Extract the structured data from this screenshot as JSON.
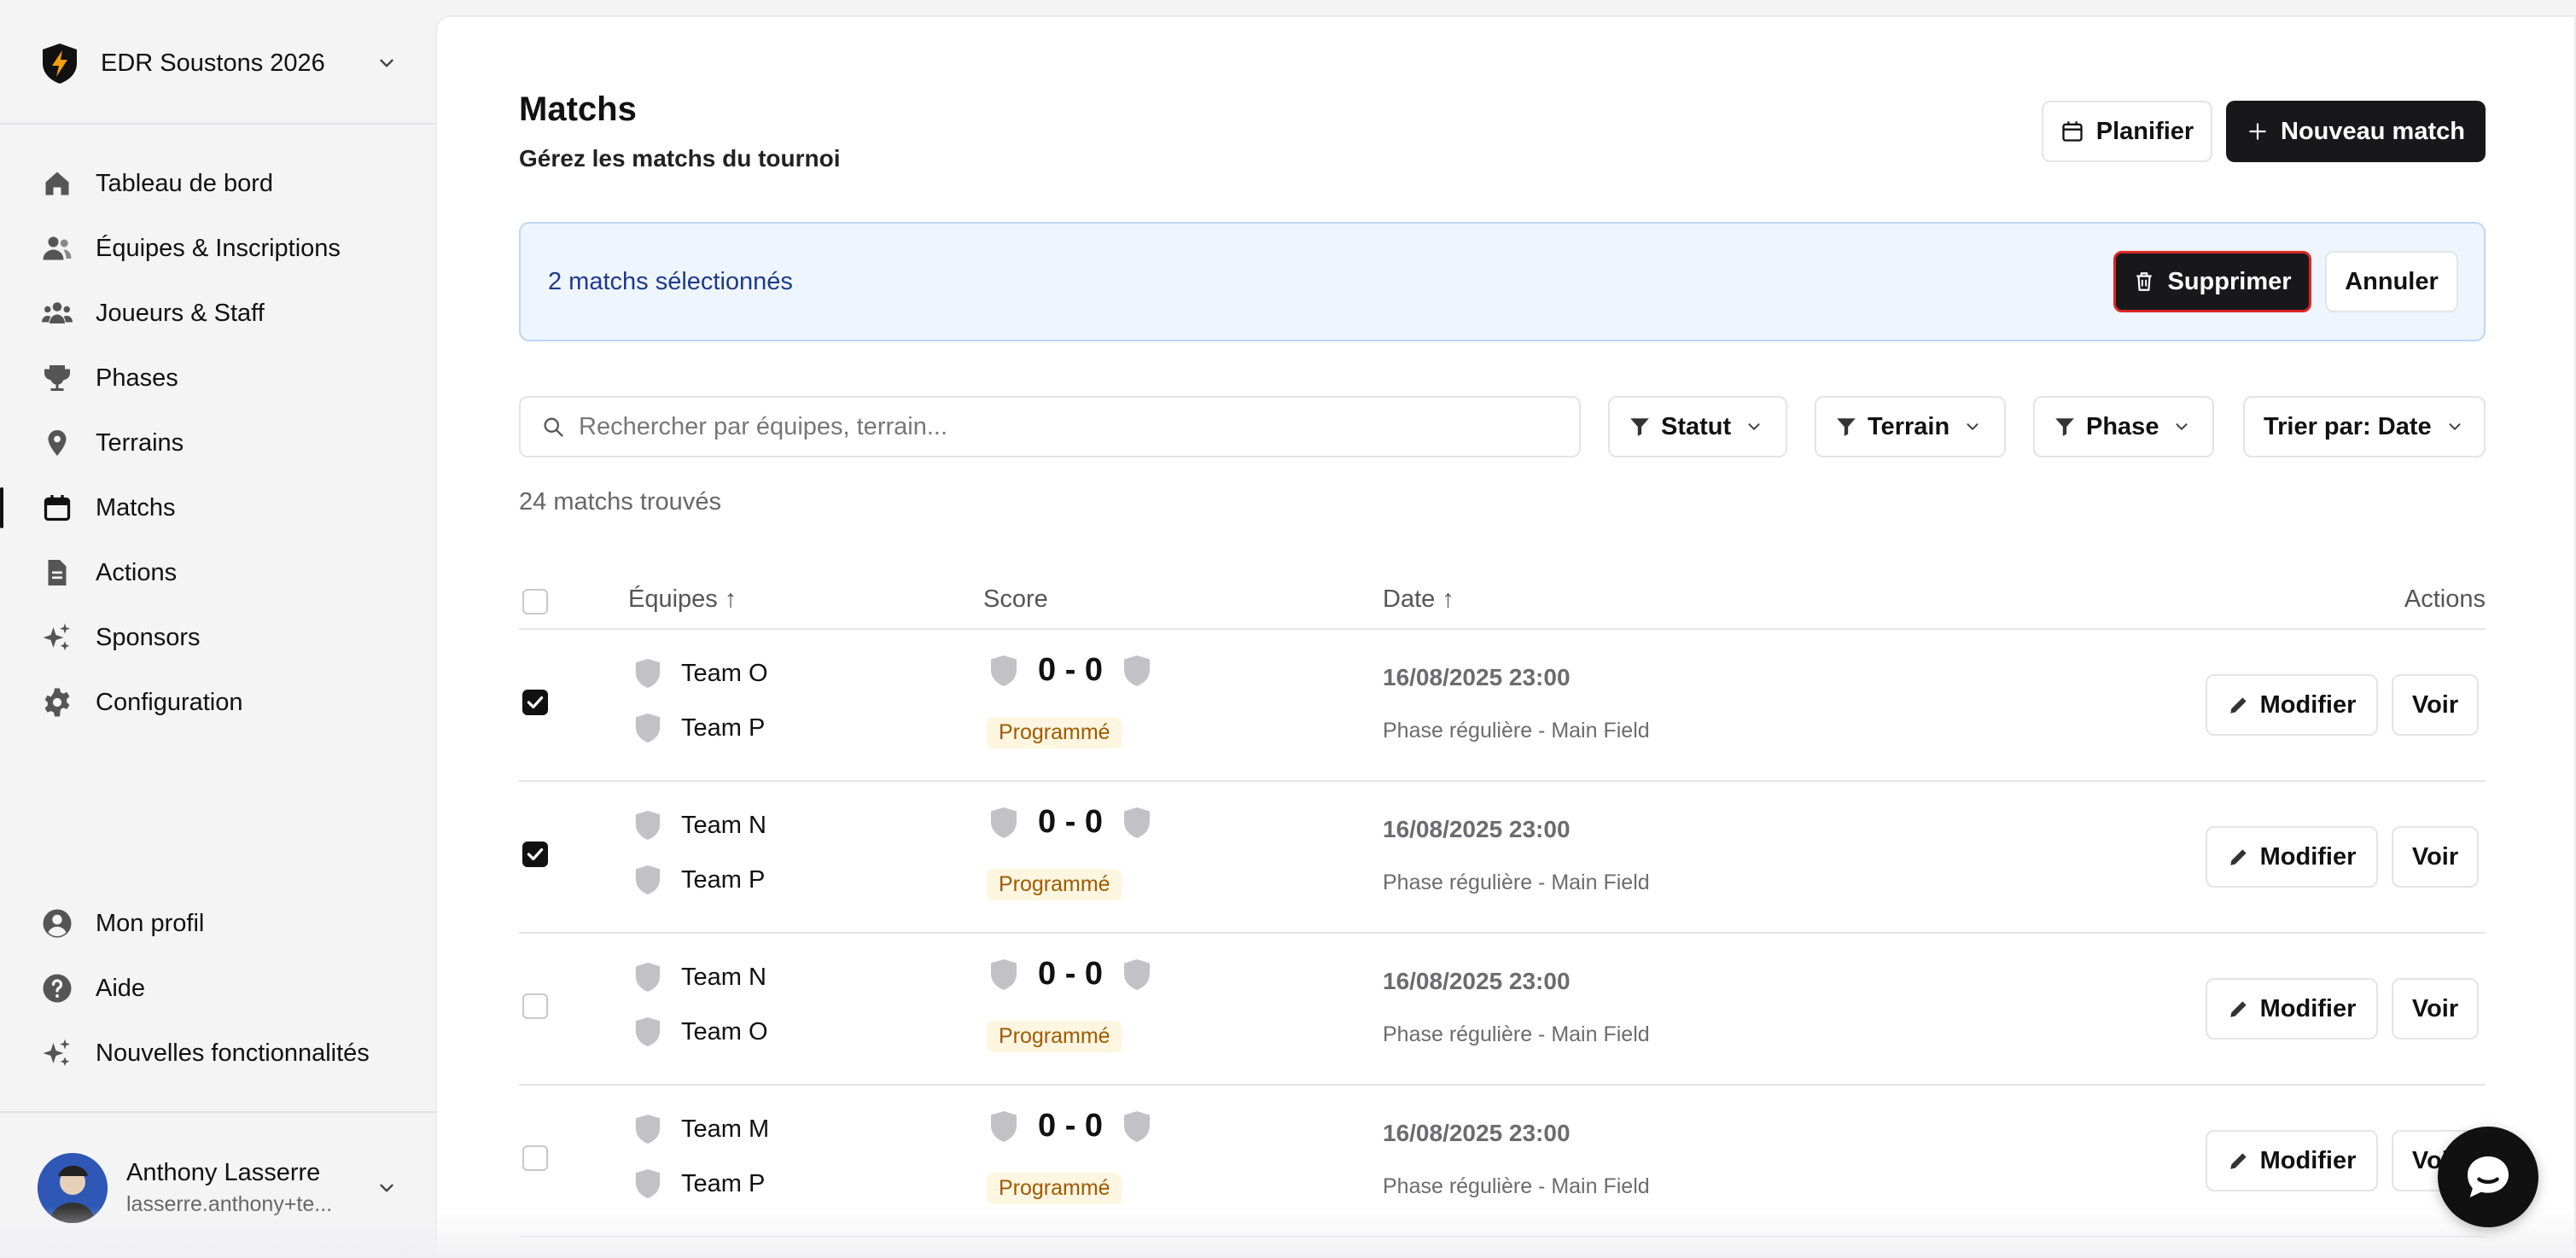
{
  "sidebar": {
    "org_name": "EDR Soustons 2026",
    "items": [
      {
        "label": "Tableau de bord",
        "icon": "home-icon"
      },
      {
        "label": "Équipes & Inscriptions",
        "icon": "users-icon"
      },
      {
        "label": "Joueurs & Staff",
        "icon": "group-icon"
      },
      {
        "label": "Phases",
        "icon": "trophy-icon"
      },
      {
        "label": "Terrains",
        "icon": "map-pin-icon"
      },
      {
        "label": "Matchs",
        "icon": "calendar-icon",
        "active": true
      },
      {
        "label": "Actions",
        "icon": "document-icon"
      },
      {
        "label": "Sponsors",
        "icon": "sparkles-icon"
      },
      {
        "label": "Configuration",
        "icon": "gear-icon"
      }
    ],
    "bottom_items": [
      {
        "label": "Mon profil",
        "icon": "user-circle-icon"
      },
      {
        "label": "Aide",
        "icon": "help-icon"
      },
      {
        "label": "Nouvelles fonctionnalités",
        "icon": "sparkles-icon"
      }
    ],
    "user": {
      "name": "Anthony Lasserre",
      "email": "lasserre.anthony+te..."
    }
  },
  "header": {
    "title": "Matchs",
    "subtitle": "Gérez les matchs du tournoi",
    "plan_label": "Planifier",
    "new_label": "Nouveau match"
  },
  "selection": {
    "text": "2 matchs sélectionnés",
    "delete_label": "Supprimer",
    "cancel_label": "Annuler"
  },
  "filters": {
    "search_placeholder": "Rechercher par équipes, terrain...",
    "status_label": "Statut",
    "field_label": "Terrain",
    "phase_label": "Phase",
    "sort_label": "Trier par: Date"
  },
  "results_count": "24 matchs trouvés",
  "table": {
    "columns": {
      "teams": "Équipes ↑",
      "score": "Score",
      "date": "Date ↑",
      "actions": "Actions"
    },
    "edit_label": "Modifier",
    "view_label": "Voir",
    "rows": [
      {
        "checked": true,
        "team1": "Team O",
        "team2": "Team P",
        "score": "0 - 0",
        "status": "Programmé",
        "date": "16/08/2025 23:00",
        "phase": "Phase régulière - Main Field"
      },
      {
        "checked": true,
        "team1": "Team N",
        "team2": "Team P",
        "score": "0 - 0",
        "status": "Programmé",
        "date": "16/08/2025 23:00",
        "phase": "Phase régulière - Main Field"
      },
      {
        "checked": false,
        "team1": "Team N",
        "team2": "Team O",
        "score": "0 - 0",
        "status": "Programmé",
        "date": "16/08/2025 23:00",
        "phase": "Phase régulière - Main Field"
      },
      {
        "checked": false,
        "team1": "Team M",
        "team2": "Team P",
        "score": "0 - 0",
        "status": "Programmé",
        "date": "16/08/2025 23:00",
        "phase": "Phase régulière - Main Field"
      }
    ]
  },
  "colors": {
    "accent_dark": "#18181b",
    "banner_bg": "#eef5fd",
    "badge_bg": "#fef6e0",
    "danger": "#dc2626"
  }
}
